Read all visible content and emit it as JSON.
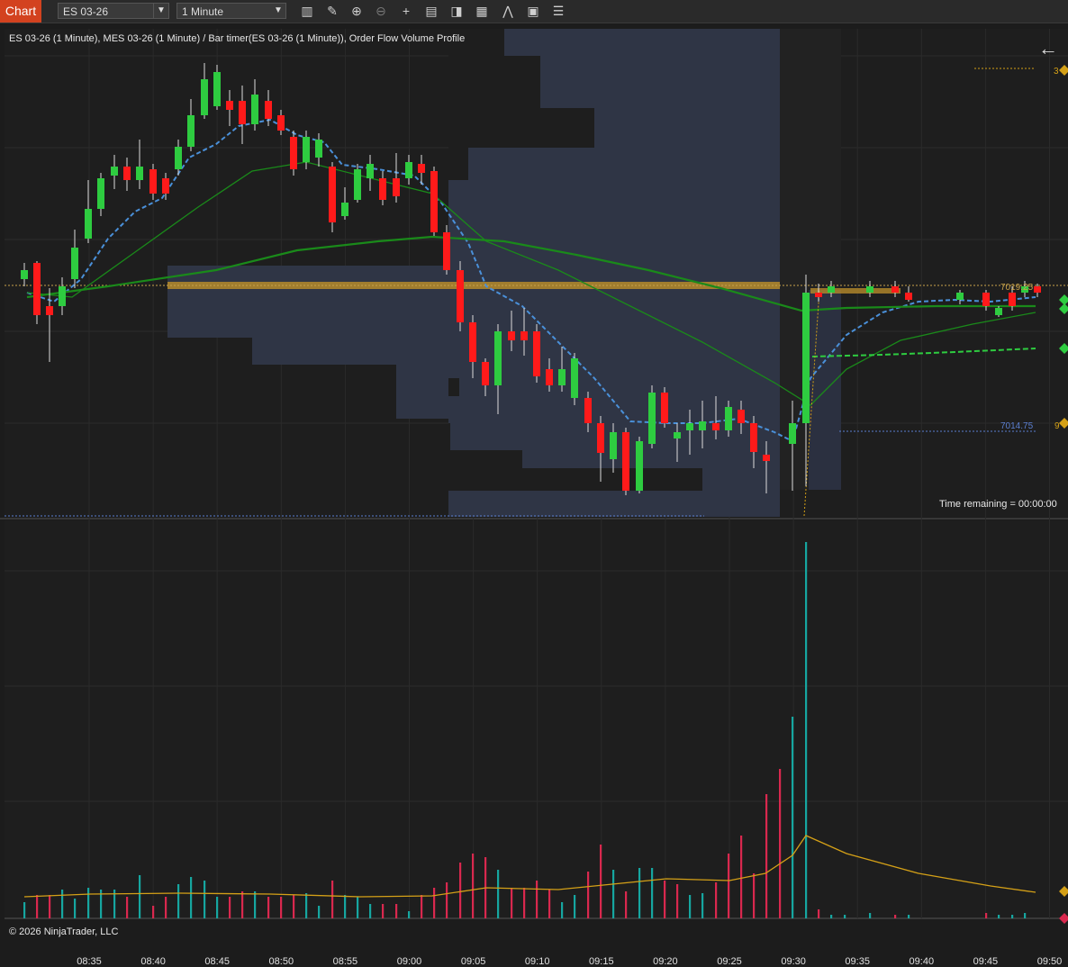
{
  "toolbar": {
    "chart_tab": "Chart",
    "instrument": "ES 03-26",
    "interval": "1 Minute",
    "icons": [
      "bar-type-icon",
      "draw-icon",
      "zoom-in-icon",
      "zoom-out-icon",
      "crosshair-icon",
      "data-box-icon",
      "properties-icon",
      "strategies-icon",
      "indicators-icon",
      "templates-icon",
      "menu-icon"
    ]
  },
  "chart": {
    "title": "ES 03-26 (1 Minute), MES 03-26 (1 Minute) / Bar timer(ES 03-26 (1 Minute)), Order Flow Volume Profile",
    "time_remaining": "Time remaining = 00:00:00",
    "copyright": "© 2026 NinjaTrader, LLC",
    "price_labels": {
      "upper": "7019.25",
      "lower": "7014.75",
      "marker_top": "3",
      "marker_low": "9"
    },
    "colors": {
      "up": "#2ecc40",
      "down": "#ff1a1a",
      "volume_up": "#16a6a0",
      "volume_down": "#d9284e",
      "ma_fast": "#4a90d9",
      "ma_green": "#1a8a1a",
      "profile": "#2f3545",
      "poc": "#b58a2a",
      "volume_avg": "#d4a017"
    }
  },
  "chart_data": {
    "type": "candlestick",
    "x_ticks": [
      "08:35",
      "08:40",
      "08:45",
      "08:50",
      "08:55",
      "09:00",
      "09:05",
      "09:10",
      "09:15",
      "09:20",
      "09:25",
      "09:30",
      "09:35",
      "09:40",
      "09:45",
      "09:50"
    ],
    "upper_price_line": 7019.25,
    "lower_price_line": 7014.75
  }
}
